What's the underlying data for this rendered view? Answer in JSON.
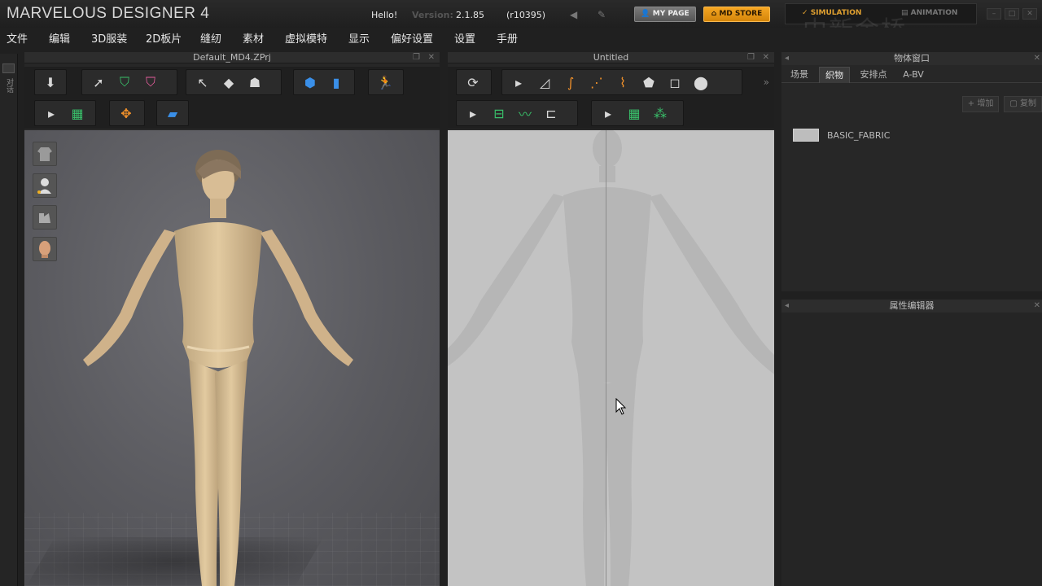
{
  "titlebar": {
    "brand": "MARVELOUS DESIGNER 4",
    "hello": "Hello!",
    "version_label": "Version:",
    "version": "2.1.85",
    "revision": "(r10395)",
    "my_page": "MY PAGE",
    "md_store": "MD STORE",
    "mode_simulation": "SIMULATION",
    "mode_animation": "ANIMATION",
    "watermark": "中新金桥"
  },
  "menu": [
    "文件",
    "编辑",
    "3D服装",
    "2D板片",
    "缝纫",
    "素材",
    "虚拟模特",
    "显示",
    "偏好设置",
    "设置",
    "手册"
  ],
  "left_strip": {
    "label": "对话"
  },
  "panel3d": {
    "title": "Default_MD4.ZPrj"
  },
  "panel2d": {
    "title": "Untitled"
  },
  "object_window": {
    "title": "物体窗口",
    "tabs": [
      "场景",
      "织物",
      "安排点",
      "A-BV"
    ],
    "active_tab": "织物",
    "add_label": "增加",
    "copy_label": "复制",
    "fabric_name": "BASIC_FABRIC"
  },
  "property_editor": {
    "title": "属性编辑器"
  },
  "colors": {
    "accent": "#f5a623",
    "viewport2d": "#c3c3c3"
  }
}
